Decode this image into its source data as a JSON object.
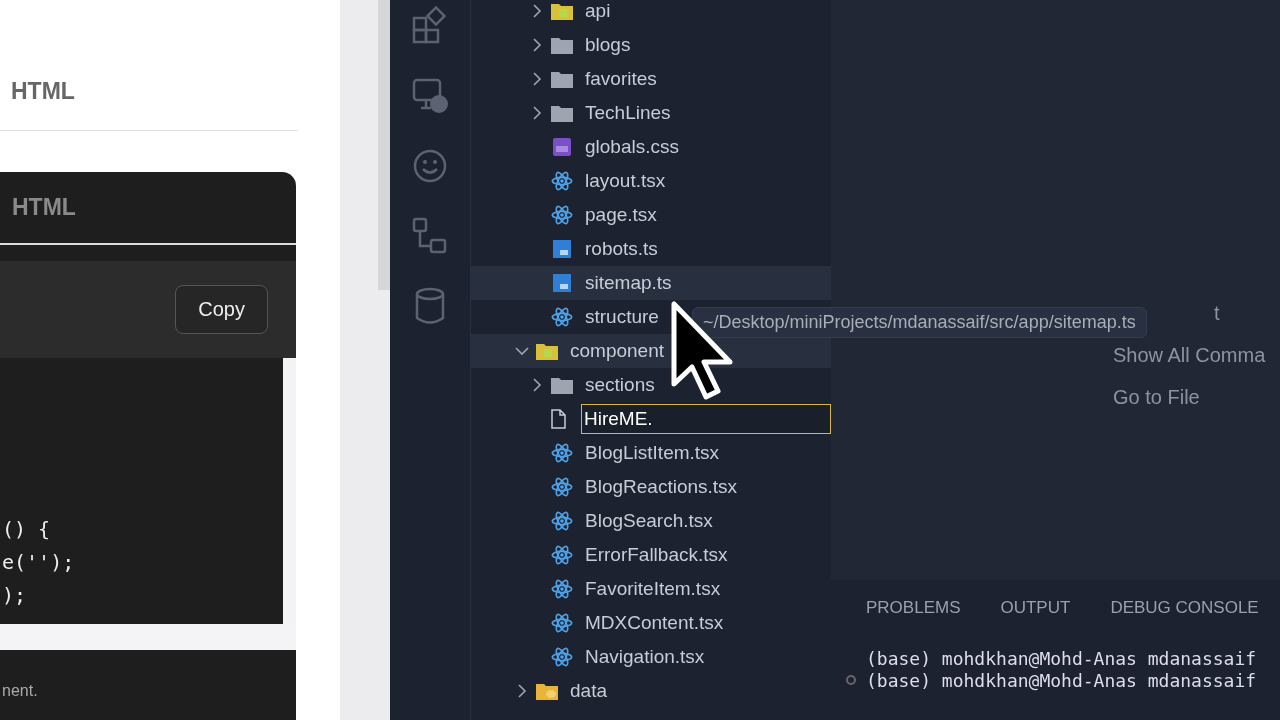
{
  "docs_page": {
    "heading": "HTML",
    "code_card": {
      "title": "HTML",
      "copy_button": "Copy",
      "code_lines": [
        "() {",
        "e('');",
        ");"
      ],
      "footer_text": "nent."
    }
  },
  "explorer": {
    "app_items": [
      {
        "name": "api",
        "kind": "special-folder",
        "expanded": false,
        "selected": false
      },
      {
        "name": "blogs",
        "kind": "folder",
        "expanded": false,
        "selected": false
      },
      {
        "name": "favorites",
        "kind": "folder",
        "expanded": false,
        "selected": false
      },
      {
        "name": "TechLines",
        "kind": "folder",
        "expanded": false,
        "selected": false
      },
      {
        "name": "globals.css",
        "kind": "css",
        "selected": false
      },
      {
        "name": "layout.tsx",
        "kind": "react",
        "selected": false
      },
      {
        "name": "page.tsx",
        "kind": "react",
        "selected": false
      },
      {
        "name": "robots.ts",
        "kind": "ts",
        "selected": false
      },
      {
        "name": "sitemap.ts",
        "kind": "ts",
        "selected": true
      },
      {
        "name": "structure",
        "kind": "react",
        "selected": false
      }
    ],
    "tree": [
      {
        "name": "component",
        "kind": "special-folder",
        "expanded": true,
        "selected": true,
        "children": [
          {
            "name": "sections",
            "kind": "folder",
            "expanded": false,
            "selected": false
          },
          {
            "name": "HireME.",
            "kind": "new-file",
            "selected": false
          },
          {
            "name": "BlogListItem.tsx",
            "kind": "react",
            "selected": false
          },
          {
            "name": "BlogReactions.tsx",
            "kind": "react",
            "selected": false
          },
          {
            "name": "BlogSearch.tsx",
            "kind": "react",
            "selected": false
          },
          {
            "name": "ErrorFallback.tsx",
            "kind": "react",
            "selected": false
          },
          {
            "name": "FavoriteItem.tsx",
            "kind": "react",
            "selected": false
          },
          {
            "name": "MDXContent.tsx",
            "kind": "react",
            "selected": false
          },
          {
            "name": "Navigation.tsx",
            "kind": "react",
            "selected": false
          }
        ]
      },
      {
        "name": "data",
        "kind": "data-folder",
        "expanded": false,
        "selected": false
      }
    ]
  },
  "tooltip": "~/Desktop/miniProjects/mdanassaif/src/app/sitemap.ts",
  "editor": {
    "hint_fragment": "t",
    "commands": [
      "Show All Comma",
      "Go to File"
    ]
  },
  "panel": {
    "tabs": [
      {
        "label": "PROBLEMS",
        "selected": false
      },
      {
        "label": "OUTPUT",
        "selected": false
      },
      {
        "label": "DEBUG CONSOLE",
        "selected": false
      }
    ],
    "terminal_lines": [
      {
        "text": "(base) mohdkhan@Mohd-Anas mdanassaif",
        "marker": false
      },
      {
        "text": "(base) mohdkhan@Mohd-Anas mdanassaif",
        "marker": true
      }
    ]
  }
}
